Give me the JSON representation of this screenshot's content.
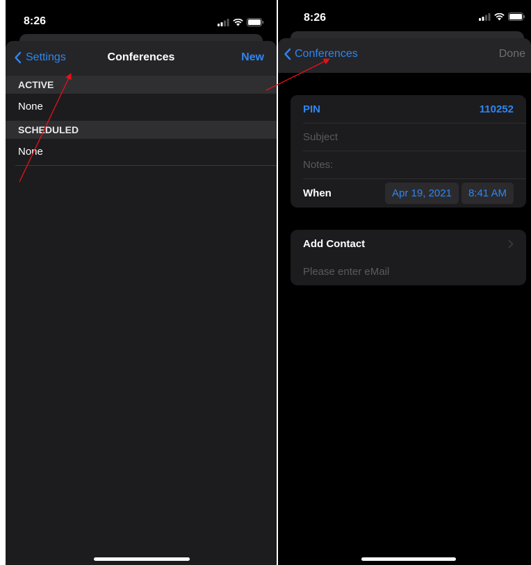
{
  "left_screen": {
    "status_time": "8:26",
    "nav": {
      "back_label": "Settings",
      "title": "Conferences",
      "right_label": "New"
    },
    "sections": [
      {
        "header": "ACTIVE",
        "rows": [
          "None"
        ]
      },
      {
        "header": "SCHEDULED",
        "rows": [
          "None"
        ]
      }
    ]
  },
  "right_screen": {
    "status_time": "8:26",
    "nav": {
      "back_label": "Conferences",
      "right_label": "Done"
    },
    "details": {
      "pin_label": "PIN",
      "pin_value": "110252",
      "subject_placeholder": "Subject",
      "notes_placeholder": "Notes:",
      "when_label": "When",
      "date_value": "Apr 19, 2021",
      "time_value": "8:41 AM"
    },
    "contact": {
      "add_contact_label": "Add Contact",
      "email_placeholder": "Please enter eMail"
    }
  },
  "colors": {
    "accent": "#2f86f2",
    "annotation": "#e8101a",
    "background": "#000000",
    "cell": "#1c1c1e"
  }
}
